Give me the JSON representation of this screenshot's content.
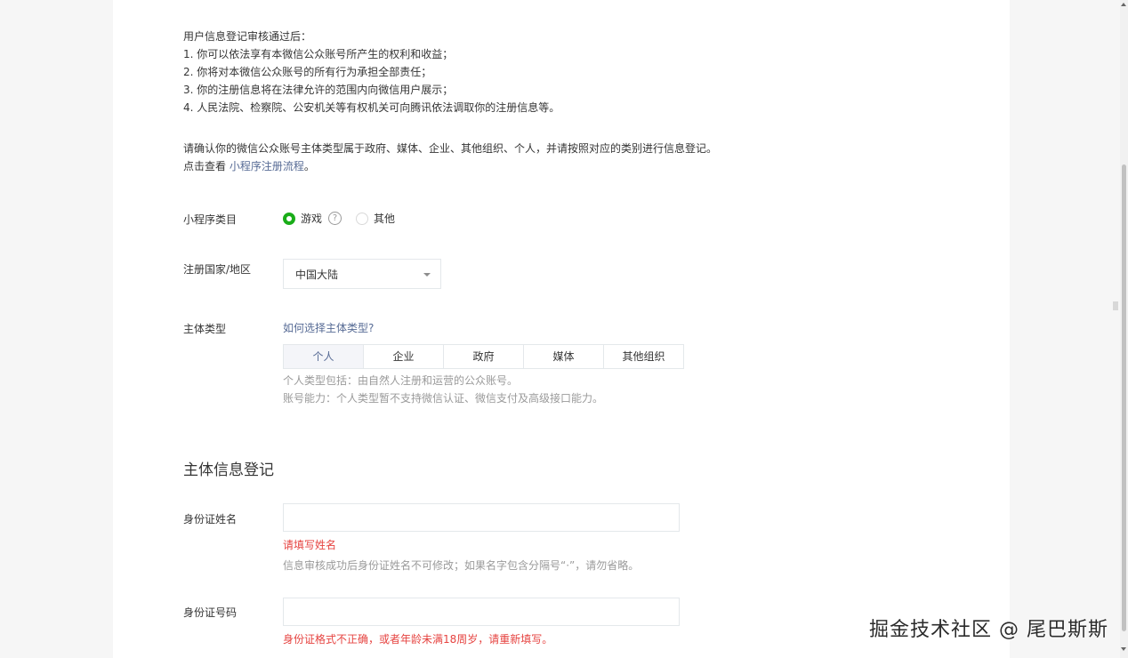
{
  "intro": {
    "lines": [
      "用户信息登记审核通过后：",
      "1. 你可以依法享有本微信公众账号所产生的权利和收益；",
      "2. 你将对本微信公众账号的所有行为承担全部责任；",
      "3. 你的注册信息将在法律允许的范围内向微信用户展示；",
      "4. 人民法院、检察院、公安机关等有权机关可向腾讯依法调取你的注册信息等。"
    ],
    "confirm_text": "请确认你的微信公众账号主体类型属于政府、媒体、企业、其他组织、个人，并请按照对应的类别进行信息登记。",
    "view_prefix": "点击查看",
    "view_link": "小程序注册流程",
    "view_suffix": "。"
  },
  "category": {
    "label": "小程序类目",
    "options": [
      {
        "label": "游戏",
        "selected": true
      },
      {
        "label": "其他",
        "selected": false
      }
    ],
    "help_glyph": "?"
  },
  "region": {
    "label": "注册国家/地区",
    "selected": "中国大陆"
  },
  "entity_type": {
    "label": "主体类型",
    "help_link": "如何选择主体类型?",
    "tabs": [
      "个人",
      "企业",
      "政府",
      "媒体",
      "其他组织"
    ],
    "active_tab": "个人",
    "hint_lines": [
      "个人类型包括：由自然人注册和运营的公众账号。",
      "账号能力：个人类型暂不支持微信认证、微信支付及高级接口能力。"
    ]
  },
  "registration": {
    "section_title": "主体信息登记",
    "name_label": "身份证姓名",
    "name_value": "",
    "name_error": "请填写姓名",
    "name_hint": "信息审核成功后身份证姓名不可修改；如果名字包含分隔号“·”，请勿省略。",
    "id_label": "身份证号码",
    "id_value": "",
    "id_error": "身份证格式不正确，或者年龄未满18周岁，请重新填写。"
  },
  "watermark": "掘金技术社区 @ 尾巴斯斯",
  "colors": {
    "accent_green": "#1aad19",
    "link_blue": "#576b95",
    "error_red": "#e64340",
    "hint_gray": "#9a9a9a"
  }
}
